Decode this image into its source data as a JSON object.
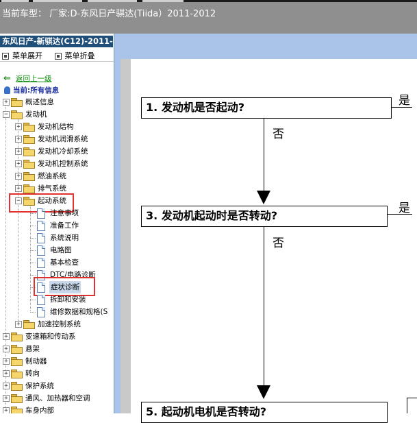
{
  "header": {
    "title": "当前车型： 厂家:D-东风日产骐达(Tiida）2011-2012"
  },
  "sidebar": {
    "title": "东风日产-新骐达(C12)-2011-",
    "expand_all": "菜单展开",
    "collapse_all": "菜单折叠",
    "back": "返回上一级",
    "current": "当前:所有信息",
    "tree": [
      {
        "label": "概述信息"
      },
      {
        "label": "发动机"
      },
      {
        "label": "发动机结构"
      },
      {
        "label": "发动机润滑系统"
      },
      {
        "label": "发动机冷却系统"
      },
      {
        "label": "发动机控制系统"
      },
      {
        "label": "燃油系统"
      },
      {
        "label": "排气系统"
      },
      {
        "label": "起动系统"
      },
      {
        "label": "注意事项"
      },
      {
        "label": "准备工作"
      },
      {
        "label": "系统说明"
      },
      {
        "label": "电路图"
      },
      {
        "label": "基本检查"
      },
      {
        "label": "DTC/电路诊断"
      },
      {
        "label": "症状诊断"
      },
      {
        "label": "拆卸和安装"
      },
      {
        "label": "维修数据和规格(S"
      },
      {
        "label": "加速控制系统"
      },
      {
        "label": "变速箱和传动系"
      },
      {
        "label": "悬架"
      },
      {
        "label": "制动器"
      },
      {
        "label": "转向"
      },
      {
        "label": "保护系统"
      },
      {
        "label": "通风、加热器和空调"
      },
      {
        "label": "车身内部"
      }
    ]
  },
  "flowchart": {
    "steps": [
      {
        "text": "1. 发动机是否起动?"
      },
      {
        "text": "3. 发动机起动时是否转动?"
      },
      {
        "text": "5. 起动机电机是否转动?"
      }
    ],
    "yes_label": "是",
    "no_label": "否"
  }
}
